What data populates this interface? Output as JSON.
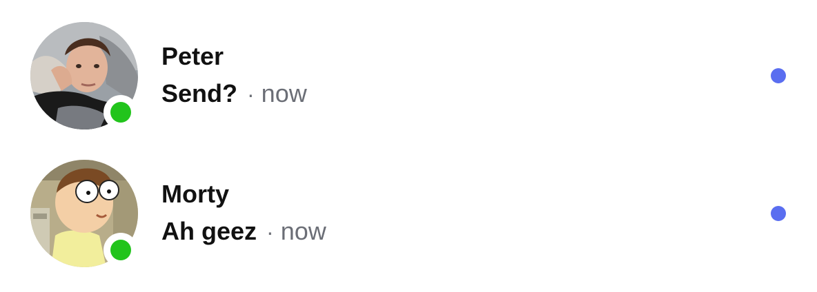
{
  "colors": {
    "presence": "#22c41c",
    "unread": "#5a6ef0",
    "primary_text": "#111111",
    "secondary_text": "#6b6e76"
  },
  "conversations": [
    {
      "name": "Peter",
      "message": "Send?",
      "separator": "·",
      "time": "now",
      "online": true,
      "unread": true,
      "avatar_icon": "person-photo"
    },
    {
      "name": "Morty",
      "message": "Ah geez",
      "separator": "·",
      "time": "now",
      "online": true,
      "unread": true,
      "avatar_icon": "cartoon-character"
    }
  ]
}
